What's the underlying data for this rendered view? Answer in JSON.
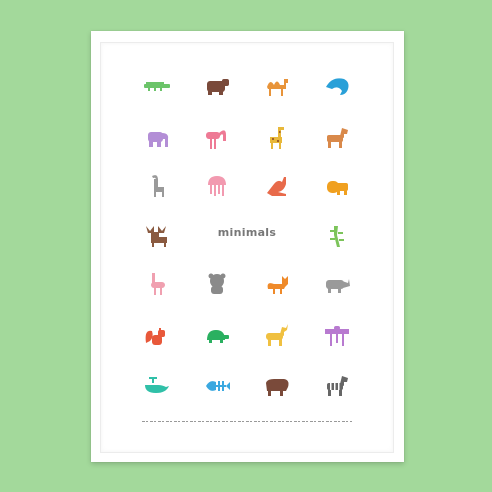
{
  "poster": {
    "title": "minimals",
    "caption": "",
    "colors": {
      "background": "#a3d99b",
      "frame": "#ffffff",
      "title": "#777777"
    }
  },
  "animals": [
    {
      "name": "crocodile-icon",
      "color": "#6cc46a"
    },
    {
      "name": "bear-icon",
      "color": "#7a4a3a"
    },
    {
      "name": "camel-icon",
      "color": "#e8943a"
    },
    {
      "name": "dolphin-icon",
      "color": "#29a0d8"
    },
    {
      "name": "elephant-icon",
      "color": "#b38ed6"
    },
    {
      "name": "flamingo-icon",
      "color": "#ee7a95"
    },
    {
      "name": "giraffe-icon",
      "color": "#e8b83a"
    },
    {
      "name": "horse-icon",
      "color": "#d9894a"
    },
    {
      "name": "ibex-icon",
      "color": "#9a9a9a"
    },
    {
      "name": "jellyfish-icon",
      "color": "#f29ab0"
    },
    {
      "name": "kangaroo-icon",
      "color": "#e86a4a"
    },
    {
      "name": "lion-icon",
      "color": "#f0a020"
    },
    {
      "name": "moose-icon",
      "color": "#8a5a40"
    },
    {
      "name": "lizard-icon",
      "color": "#7cc45a"
    },
    {
      "name": "ostrich-icon",
      "color": "#f0a0b0"
    },
    {
      "name": "panda-icon",
      "color": "#8a8a8a"
    },
    {
      "name": "fox-icon",
      "color": "#ef8a2a"
    },
    {
      "name": "rhino-icon",
      "color": "#9a9a9a"
    },
    {
      "name": "squirrel-icon",
      "color": "#e8583a"
    },
    {
      "name": "turtle-icon",
      "color": "#2ab060"
    },
    {
      "name": "unicorn-icon",
      "color": "#f0c040"
    },
    {
      "name": "vulture-icon",
      "color": "#b87ad0"
    },
    {
      "name": "whale-icon",
      "color": "#30c0a8"
    },
    {
      "name": "fish-skeleton-icon",
      "color": "#3aa8e0"
    },
    {
      "name": "yak-icon",
      "color": "#7a4a3a"
    },
    {
      "name": "zebra-icon",
      "color": "#666666"
    }
  ]
}
